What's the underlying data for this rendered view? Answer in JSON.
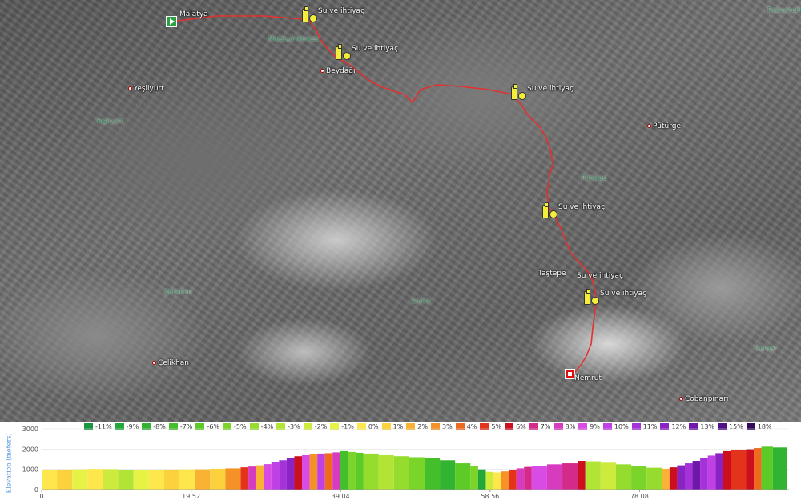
{
  "map": {
    "start": {
      "label": "Malatya"
    },
    "end": {
      "label": "Nemrut"
    },
    "places": [
      {
        "id": "yesilyurt",
        "label": "Yeşilyurt",
        "kind": "town"
      },
      {
        "id": "beydagi",
        "label": "Beydağı",
        "kind": "town"
      },
      {
        "id": "puturge",
        "label": "Pütürge",
        "kind": "town"
      },
      {
        "id": "tastepe",
        "label": "Taştepe",
        "kind": "village"
      },
      {
        "id": "celikhan",
        "label": "Çelikhan",
        "kind": "town"
      },
      {
        "id": "cobanpinari",
        "label": "Çobanpınarı",
        "kind": "town"
      }
    ],
    "areas": [
      {
        "id": "malatya-merkez",
        "label": "Malatya Merkez"
      },
      {
        "id": "yesilyurt-area",
        "label": "Yeşilyurt"
      },
      {
        "id": "puturge-area",
        "label": "Pütürge"
      },
      {
        "id": "celikhan-area",
        "label": "Çelikhan"
      },
      {
        "id": "sincik-area",
        "label": "Sincik"
      },
      {
        "id": "gerger-area",
        "label": "Gerger"
      },
      {
        "id": "dogansehir-area",
        "label": "Doğanşehir"
      }
    ],
    "pois": [
      {
        "label": "Su ve ihtiyaç",
        "icon": "water-food-icon"
      },
      {
        "label": "Su ve ihtiyaç",
        "icon": "water-food-icon"
      },
      {
        "label": "Su ve ihtiyaç",
        "icon": "water-food-icon"
      },
      {
        "label": "Su ve ihtiyaç",
        "icon": "water-food-icon"
      },
      {
        "label": "Su ve ihtiyaç",
        "icon": "water-food-icon"
      },
      {
        "label": "Su ve ihtiyaç",
        "icon": "water-food-icon"
      }
    ],
    "route_color": "#e53030"
  },
  "chart_data": {
    "type": "bar",
    "ylabel": "Elevation (meters)",
    "ylim": [
      0,
      3000
    ],
    "yticks": [
      0,
      1000,
      2000,
      3000
    ],
    "xlim": [
      0,
      97.6
    ],
    "xticks": [
      0,
      19.52,
      39.04,
      58.56,
      78.08
    ],
    "legend": [
      {
        "label": "-11%",
        "color": "#1a9641"
      },
      {
        "label": "-9%",
        "color": "#22a83a"
      },
      {
        "label": "-8%",
        "color": "#33b332"
      },
      {
        "label": "-7%",
        "color": "#45be2b"
      },
      {
        "label": "-6%",
        "color": "#5ccb28"
      },
      {
        "label": "-5%",
        "color": "#7ad42a"
      },
      {
        "label": "-4%",
        "color": "#96dc2e"
      },
      {
        "label": "-3%",
        "color": "#b2e435"
      },
      {
        "label": "-2%",
        "color": "#cdeb3c"
      },
      {
        "label": "-1%",
        "color": "#e6f244"
      },
      {
        "label": "0%",
        "color": "#fde74c"
      },
      {
        "label": "1%",
        "color": "#fbd23e"
      },
      {
        "label": "2%",
        "color": "#f9b233"
      },
      {
        "label": "3%",
        "color": "#f59127"
      },
      {
        "label": "4%",
        "color": "#ef6a1f"
      },
      {
        "label": "5%",
        "color": "#e3331b"
      },
      {
        "label": "6%",
        "color": "#cc0f1e"
      },
      {
        "label": "7%",
        "color": "#d42a8a"
      },
      {
        "label": "8%",
        "color": "#d63bc0"
      },
      {
        "label": "9%",
        "color": "#d84be4"
      },
      {
        "label": "10%",
        "color": "#c040e6"
      },
      {
        "label": "11%",
        "color": "#a531d9"
      },
      {
        "label": "12%",
        "color": "#8a23c4"
      },
      {
        "label": "13%",
        "color": "#6e17a8"
      },
      {
        "label": "15%",
        "color": "#521085"
      },
      {
        "label": "18%",
        "color": "#350a5c"
      }
    ],
    "segments": [
      {
        "x": 0,
        "elev": 980,
        "grade": "0%"
      },
      {
        "x": 2,
        "elev": 990,
        "grade": "1%"
      },
      {
        "x": 4,
        "elev": 1000,
        "grade": "-1%"
      },
      {
        "x": 6,
        "elev": 1020,
        "grade": "0%"
      },
      {
        "x": 8,
        "elev": 1010,
        "grade": "-2%"
      },
      {
        "x": 10,
        "elev": 980,
        "grade": "-3%"
      },
      {
        "x": 12,
        "elev": 960,
        "grade": "-1%"
      },
      {
        "x": 14,
        "elev": 970,
        "grade": "0%"
      },
      {
        "x": 16,
        "elev": 990,
        "grade": "1%"
      },
      {
        "x": 18,
        "elev": 1000,
        "grade": "0%"
      },
      {
        "x": 20,
        "elev": 1000,
        "grade": "2%"
      },
      {
        "x": 22,
        "elev": 1030,
        "grade": "1%"
      },
      {
        "x": 24,
        "elev": 1050,
        "grade": "3%"
      },
      {
        "x": 26,
        "elev": 1100,
        "grade": "5%"
      },
      {
        "x": 27,
        "elev": 1140,
        "grade": "8%"
      },
      {
        "x": 28,
        "elev": 1200,
        "grade": "2%"
      },
      {
        "x": 29,
        "elev": 1260,
        "grade": "9%"
      },
      {
        "x": 30,
        "elev": 1350,
        "grade": "10%"
      },
      {
        "x": 31,
        "elev": 1450,
        "grade": "11%"
      },
      {
        "x": 32,
        "elev": 1550,
        "grade": "12%"
      },
      {
        "x": 33,
        "elev": 1650,
        "grade": "6%"
      },
      {
        "x": 34,
        "elev": 1700,
        "grade": "9%"
      },
      {
        "x": 35,
        "elev": 1750,
        "grade": "3%"
      },
      {
        "x": 36,
        "elev": 1780,
        "grade": "10%"
      },
      {
        "x": 37,
        "elev": 1800,
        "grade": "4%"
      },
      {
        "x": 38,
        "elev": 1840,
        "grade": "8%"
      },
      {
        "x": 39,
        "elev": 1900,
        "grade": "-7%"
      },
      {
        "x": 40,
        "elev": 1860,
        "grade": "-5%"
      },
      {
        "x": 41,
        "elev": 1820,
        "grade": "-6%"
      },
      {
        "x": 42,
        "elev": 1780,
        "grade": "-4%"
      },
      {
        "x": 44,
        "elev": 1700,
        "grade": "-3%"
      },
      {
        "x": 46,
        "elev": 1650,
        "grade": "-4%"
      },
      {
        "x": 48,
        "elev": 1600,
        "grade": "-5%"
      },
      {
        "x": 50,
        "elev": 1550,
        "grade": "-7%"
      },
      {
        "x": 52,
        "elev": 1450,
        "grade": "-8%"
      },
      {
        "x": 54,
        "elev": 1300,
        "grade": "-6%"
      },
      {
        "x": 56,
        "elev": 1150,
        "grade": "-5%"
      },
      {
        "x": 57,
        "elev": 1000,
        "grade": "-9%"
      },
      {
        "x": 58,
        "elev": 880,
        "grade": "-2%"
      },
      {
        "x": 59,
        "elev": 850,
        "grade": "0%"
      },
      {
        "x": 60,
        "elev": 900,
        "grade": "3%"
      },
      {
        "x": 61,
        "elev": 980,
        "grade": "5%"
      },
      {
        "x": 62,
        "elev": 1050,
        "grade": "8%"
      },
      {
        "x": 63,
        "elev": 1120,
        "grade": "7%"
      },
      {
        "x": 64,
        "elev": 1180,
        "grade": "9%"
      },
      {
        "x": 66,
        "elev": 1250,
        "grade": "8%"
      },
      {
        "x": 68,
        "elev": 1300,
        "grade": "7%"
      },
      {
        "x": 70,
        "elev": 1420,
        "grade": "6%"
      },
      {
        "x": 71,
        "elev": 1400,
        "grade": "-3%"
      },
      {
        "x": 73,
        "elev": 1330,
        "grade": "-2%"
      },
      {
        "x": 75,
        "elev": 1250,
        "grade": "-4%"
      },
      {
        "x": 77,
        "elev": 1150,
        "grade": "-5%"
      },
      {
        "x": 79,
        "elev": 1080,
        "grade": "-4%"
      },
      {
        "x": 81,
        "elev": 1030,
        "grade": "2%"
      },
      {
        "x": 82,
        "elev": 1100,
        "grade": "6%"
      },
      {
        "x": 83,
        "elev": 1200,
        "grade": "12%"
      },
      {
        "x": 84,
        "elev": 1300,
        "grade": "11%"
      },
      {
        "x": 85,
        "elev": 1420,
        "grade": "13%"
      },
      {
        "x": 86,
        "elev": 1550,
        "grade": "11%"
      },
      {
        "x": 87,
        "elev": 1680,
        "grade": "10%"
      },
      {
        "x": 88,
        "elev": 1800,
        "grade": "12%"
      },
      {
        "x": 89,
        "elev": 1900,
        "grade": "6%"
      },
      {
        "x": 90,
        "elev": 1950,
        "grade": "5%"
      },
      {
        "x": 92,
        "elev": 1990,
        "grade": "6%"
      },
      {
        "x": 93,
        "elev": 2050,
        "grade": "4%"
      },
      {
        "x": 94,
        "elev": 2120,
        "grade": "-6%"
      },
      {
        "x": 95.5,
        "elev": 2080,
        "grade": "-8%"
      }
    ]
  }
}
